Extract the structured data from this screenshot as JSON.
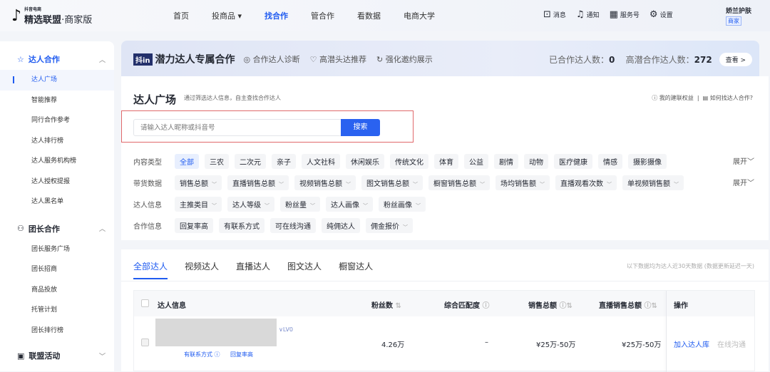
{
  "header": {
    "logo_small": "抖音电商",
    "logo_main": "精选联盟",
    "logo_sub": "·商家版",
    "nav": [
      "首页",
      "投商品",
      "找合作",
      "管合作",
      "看数据",
      "电商大学"
    ],
    "tools": [
      {
        "icon": "message-icon",
        "label": "消息"
      },
      {
        "icon": "bell-icon",
        "label": "通知"
      },
      {
        "icon": "grid-icon",
        "label": "服务号"
      },
      {
        "icon": "gear-icon",
        "label": "设置"
      }
    ],
    "user": {
      "name": "娇兰护肤",
      "badge": "商家"
    }
  },
  "sidebar": {
    "groups": [
      {
        "label": "达人合作",
        "items": [
          "达人广场",
          "智能推荐",
          "同行合作参考",
          "达人排行榜",
          "达人服务机构榜",
          "达人授权提报",
          "达人黑名单"
        ]
      },
      {
        "label": "团长合作",
        "items": [
          "团长服务广场",
          "团长招商",
          "商品投放",
          "托管计划",
          "团长排行榜"
        ]
      },
      {
        "label": "联盟活动",
        "items": []
      }
    ]
  },
  "banner": {
    "logo": "抖in",
    "title": "潜力达人专属合作",
    "features": [
      "合作达人诊断",
      "高潜头达推荐",
      "强化邀约展示"
    ],
    "stat1_label": "已合作达人数：",
    "stat1_value": "0",
    "stat2_label": "高潜合作达人数：",
    "stat2_value": "272",
    "view": "查看 >"
  },
  "main": {
    "title": "达人广场",
    "subtitle": "通过筛选达人信息，自主查找合作达人",
    "link1": "我的建联权益",
    "link2": "如何找达人合作?",
    "search_placeholder": "请输入达人昵称或抖音号",
    "search_button": "搜索",
    "expand": "展开",
    "filters": [
      {
        "label": "内容类型",
        "chips": [
          "全部",
          "三农",
          "二次元",
          "亲子",
          "人文社科",
          "休闲娱乐",
          "传统文化",
          "体育",
          "公益",
          "剧情",
          "动物",
          "医疗健康",
          "情感",
          "摄影摄像"
        ],
        "dropdown": false
      },
      {
        "label": "带货数据",
        "chips": [
          "销售总额",
          "直播销售总额",
          "视频销售总额",
          "图文销售总额",
          "橱窗销售总额",
          "场均销售额",
          "直播观看次数",
          "单视频销售额"
        ],
        "dropdown": true
      },
      {
        "label": "达人信息",
        "chips": [
          "主推类目",
          "达人等级",
          "粉丝量",
          "达人画像",
          "粉丝画像"
        ],
        "dropdown": true
      },
      {
        "label": "合作信息",
        "chips": [
          "回复率高",
          "有联系方式",
          "可在线沟通",
          "纯佣达人",
          "佣金报价"
        ],
        "dropdown": false
      }
    ]
  },
  "list": {
    "tabs": [
      "全部达人",
      "视频达人",
      "直播达人",
      "图文达人",
      "橱窗达人"
    ],
    "note": "以下数据均为达人近30天数据 (数据更新延迟一天)",
    "columns": [
      "达人信息",
      "粉丝数",
      "综合匹配度",
      "销售总额",
      "直播销售总额",
      "操作"
    ],
    "rows": [
      {
        "level": "LV0",
        "tags": [
          "有联系方式",
          "回复率高"
        ],
        "fans": "4.26万",
        "match": "–",
        "sales": "¥25万-50万",
        "live_sales": "¥25万-50万",
        "action1": "加入达人库",
        "action2": "在线沟通"
      }
    ]
  }
}
